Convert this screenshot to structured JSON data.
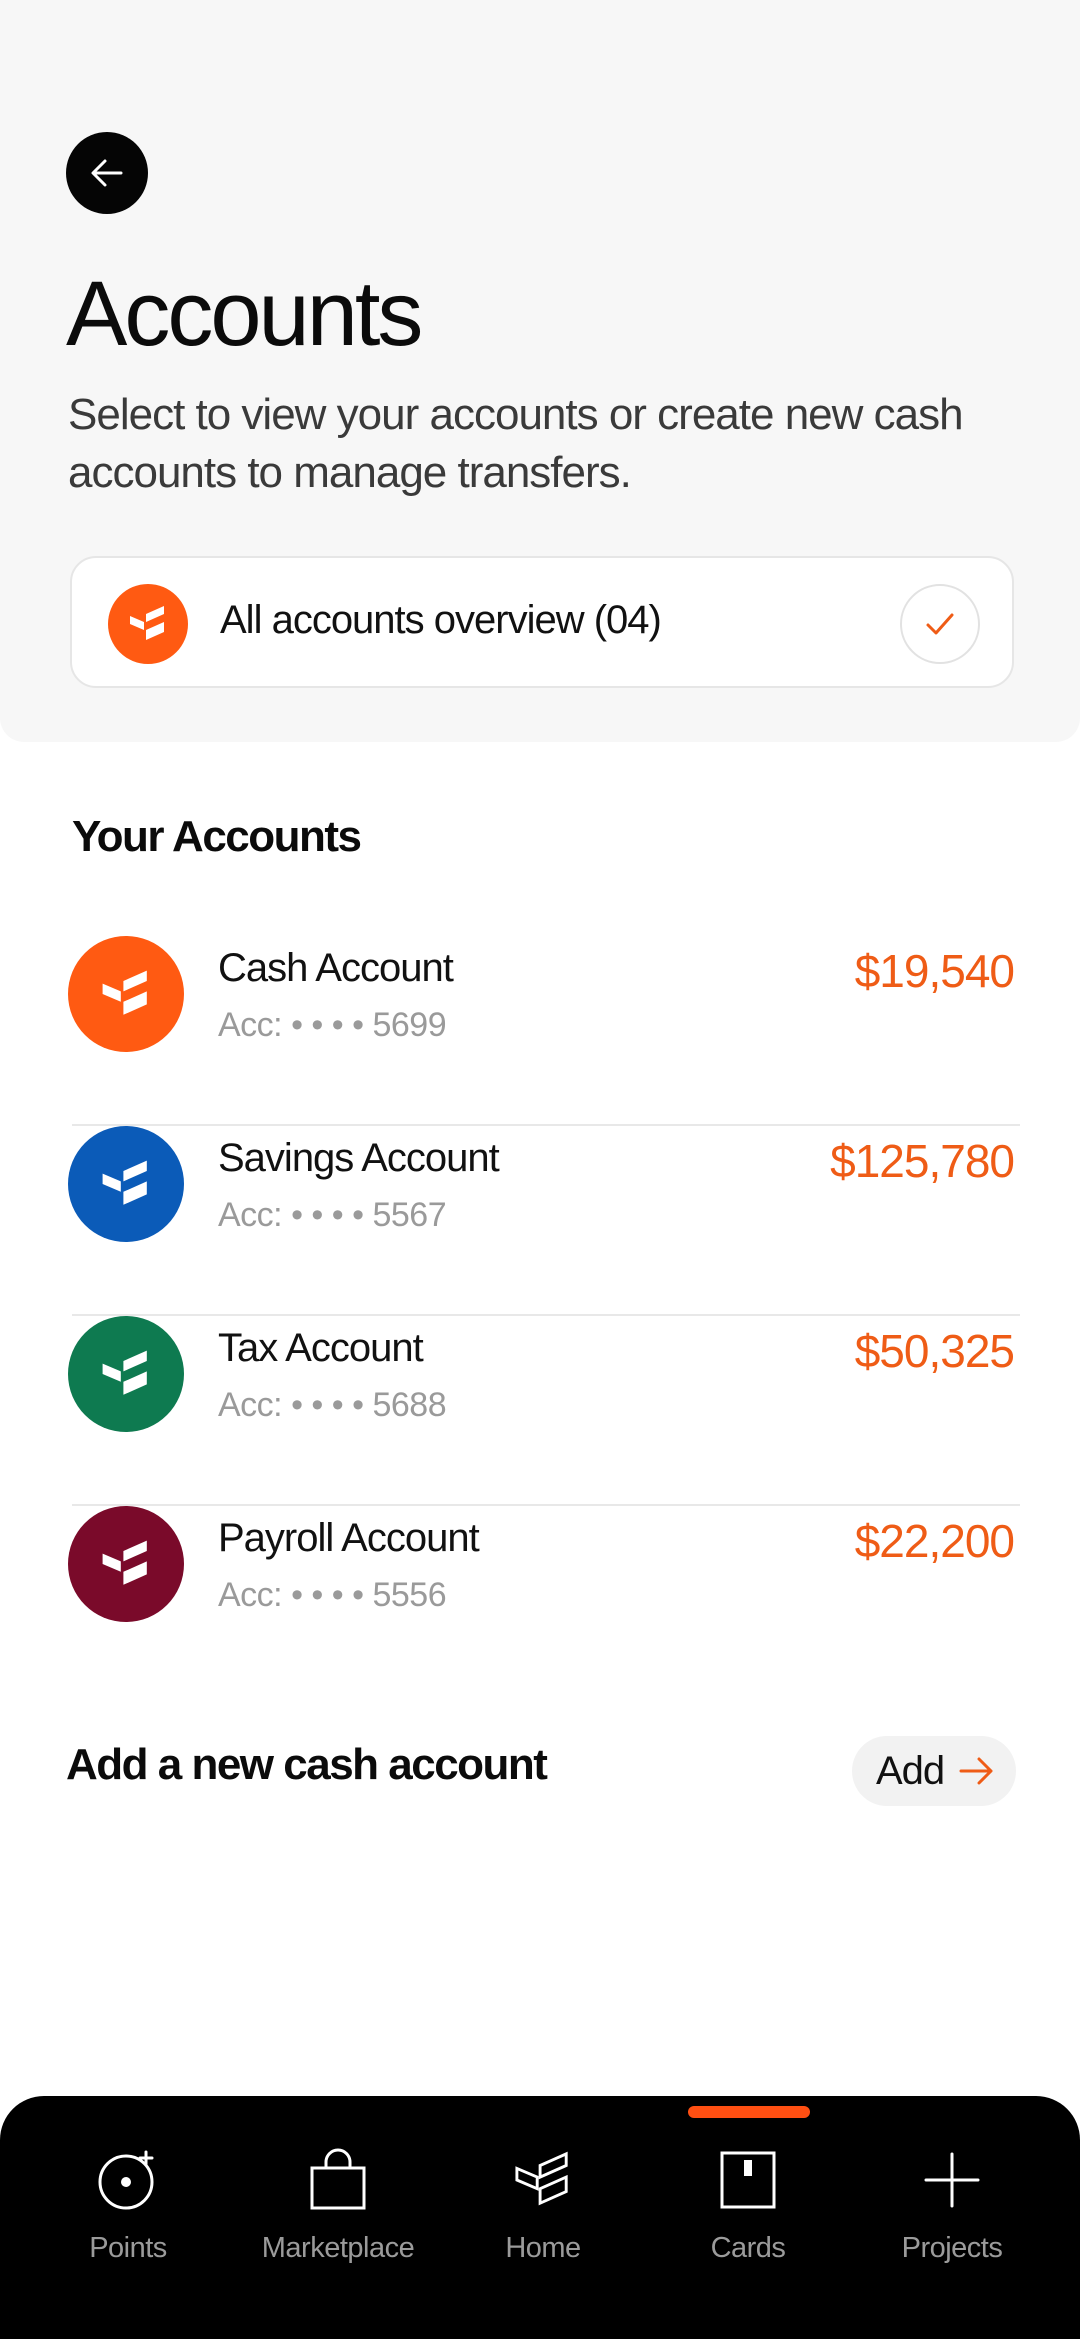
{
  "header": {
    "title": "Accounts",
    "subtitle": "Select to view your accounts or create new cash accounts to manage transfers.",
    "overview_label": "All accounts overview (04)"
  },
  "accounts_section": {
    "title": "Your Accounts",
    "accounts": [
      {
        "name": "Cash Account",
        "number": "Acc: • • • • 5699",
        "balance": "$19,540",
        "color": "#ff5a12"
      },
      {
        "name": "Savings Account",
        "number": "Acc: • • • • 5567",
        "balance": "$125,780",
        "color": "#0b5bb8"
      },
      {
        "name": "Tax Account",
        "number": "Acc: • • • • 5688",
        "balance": "$50,325",
        "color": "#0e7a50"
      },
      {
        "name": "Payroll Account",
        "number": "Acc: • • • • 5556",
        "balance": "$22,200",
        "color": "#7a0a2a"
      }
    ]
  },
  "add_account": {
    "title": "Add a new cash account",
    "button_label": "Add"
  },
  "bottom_nav": {
    "active": "Cards",
    "items": [
      {
        "label": "Points",
        "icon": "points-icon"
      },
      {
        "label": "Marketplace",
        "icon": "shopping-bag-icon"
      },
      {
        "label": "Home",
        "icon": "home-logo-icon"
      },
      {
        "label": "Cards",
        "icon": "card-icon"
      },
      {
        "label": "Projects",
        "icon": "plus-icon"
      }
    ]
  },
  "colors": {
    "accent": "#ef5c16",
    "header_bg": "#f7f7f7",
    "nav_bg": "#000000"
  }
}
